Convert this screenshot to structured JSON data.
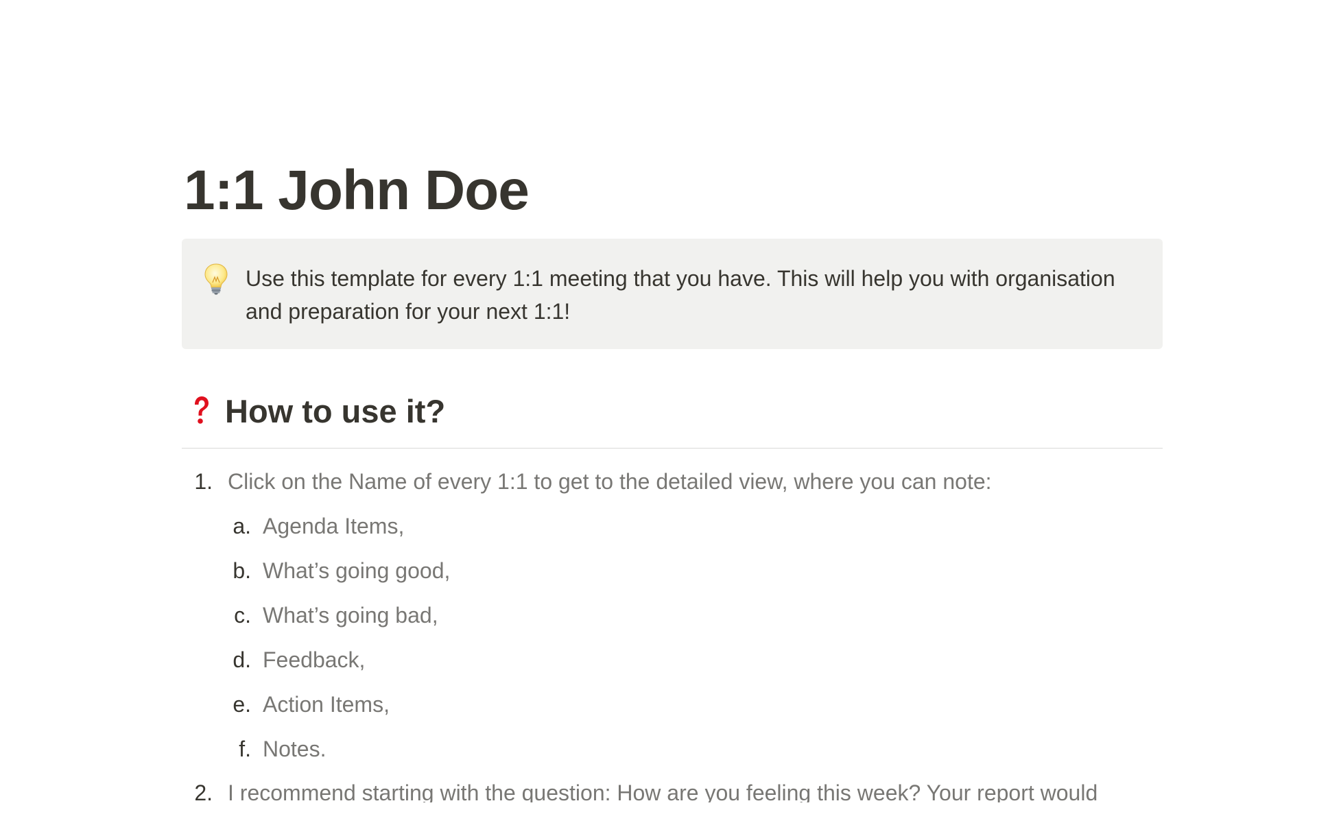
{
  "page": {
    "title": "1:1 John Doe"
  },
  "callout": {
    "icon": "lightbulb-icon",
    "line1": "Use this template for every 1:1 meeting that you have. This will help you with organisation",
    "line2": "and preparation for your next 1:1!",
    "background": "#f1f1ef"
  },
  "section": {
    "icon": "red-question-mark-icon",
    "heading": "How to use it?"
  },
  "list": {
    "items": [
      {
        "marker": "1.",
        "text": "Click on the Name of every 1:1 to get to the detailed view, where you can note:",
        "subitems": [
          {
            "marker": "a.",
            "text": "Agenda Items,"
          },
          {
            "marker": "b.",
            "text": "What’s going good,"
          },
          {
            "marker": "c.",
            "text": "What’s going bad,"
          },
          {
            "marker": "d.",
            "text": "Feedback,"
          },
          {
            "marker": "e.",
            "text": "Action Items,"
          },
          {
            "marker": "f.",
            "text": "Notes."
          }
        ]
      },
      {
        "marker": "2.",
        "text": "I recommend starting with the question: How are you feeling this week? Your report would"
      }
    ]
  },
  "colors": {
    "text": "#37352f",
    "muted_text": "#787774",
    "divider": "#d9d9d7",
    "question_mark": "#e0101e"
  }
}
